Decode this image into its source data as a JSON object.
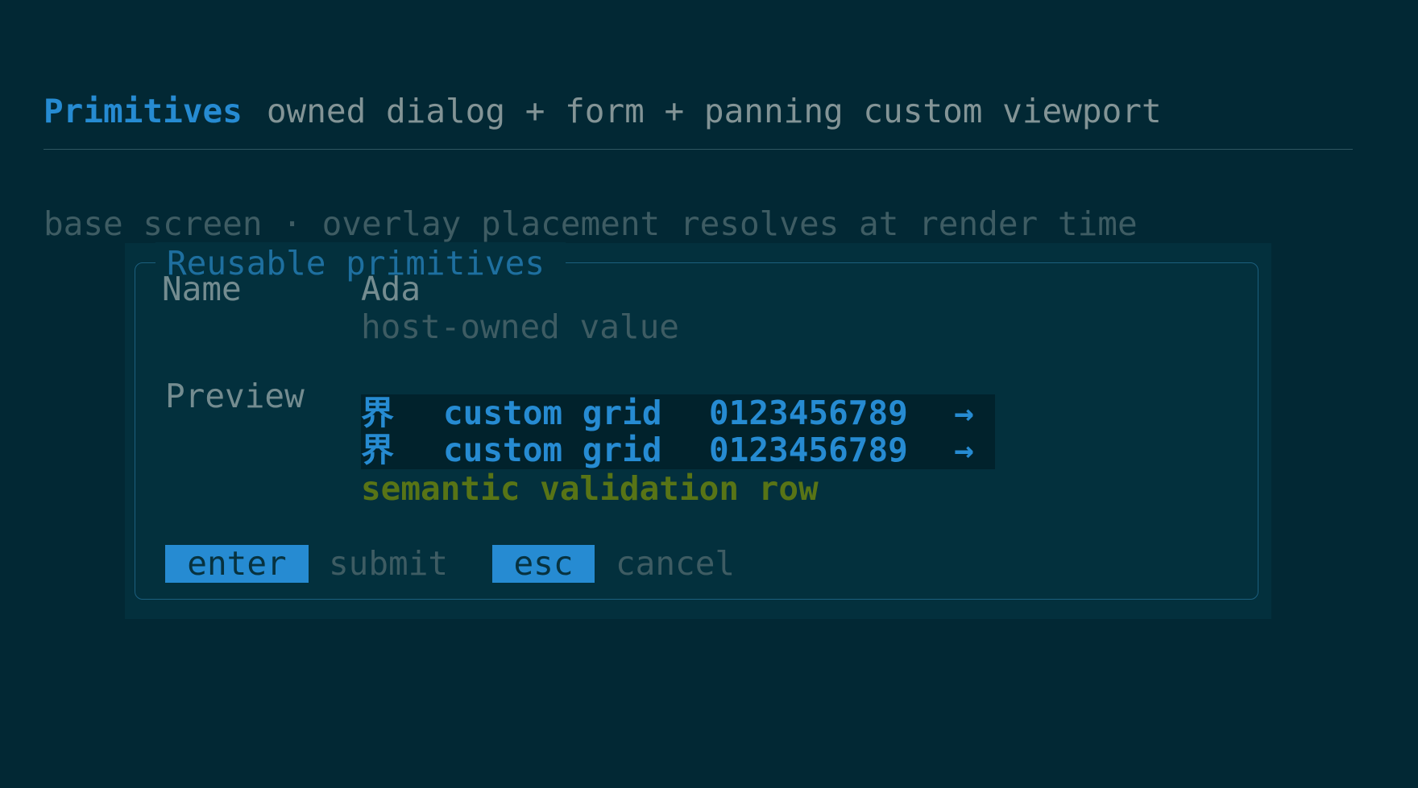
{
  "header": {
    "title": "Primitives",
    "subtitle": "owned dialog + form + panning custom viewport"
  },
  "base_screen": {
    "text": "base screen · overlay placement resolves at render time"
  },
  "dialog": {
    "title": "Reusable primitives",
    "form": {
      "name_label": "Name",
      "name_value": "Ada",
      "name_hint": "host-owned value",
      "preview_label": "Preview"
    },
    "preview_rows": [
      {
        "glyph": "界",
        "text": "custom grid",
        "digits": "0123456789",
        "arrow": "→"
      },
      {
        "glyph": "界",
        "text": "custom grid",
        "digits": "0123456789",
        "arrow": "→"
      }
    ],
    "validation_row": "semantic validation row",
    "actions": [
      {
        "key": "enter",
        "label": "submit"
      },
      {
        "key": "esc",
        "label": "cancel"
      }
    ]
  },
  "colors": {
    "background": "#022834",
    "accent": "#268bd2",
    "validation": "#587416"
  }
}
